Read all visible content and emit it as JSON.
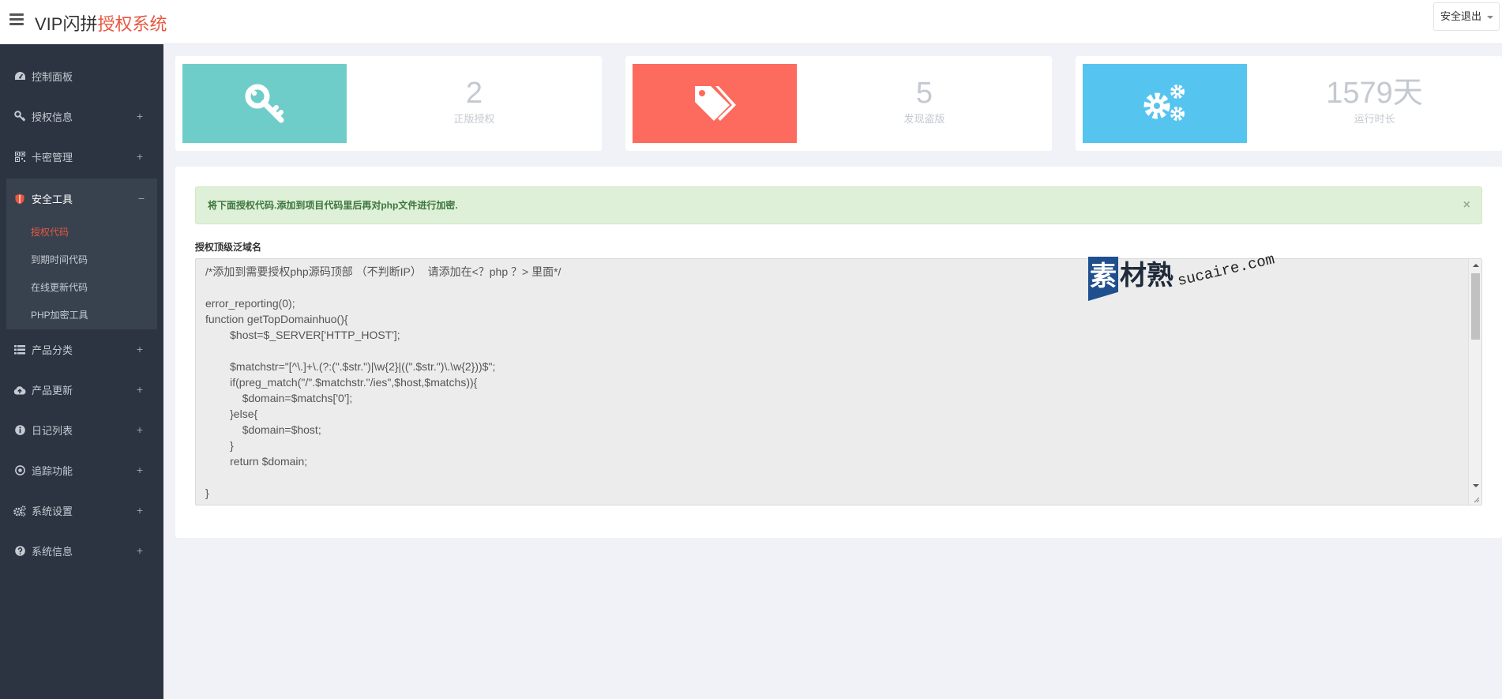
{
  "header": {
    "brand_main": "VIP闪拼",
    "brand_accent": "授权系统",
    "logout_label": "安全退出"
  },
  "sidebar": {
    "items": [
      {
        "label": "控制面板",
        "icon": "dashboard-icon"
      },
      {
        "label": "授权信息",
        "icon": "key-icon",
        "toggle": "+"
      },
      {
        "label": "卡密管理",
        "icon": "qrcode-icon",
        "toggle": "+"
      },
      {
        "label": "安全工具",
        "icon": "shield-icon",
        "toggle": "−",
        "children": [
          {
            "label": "授权代码",
            "active": true
          },
          {
            "label": "到期时间代码"
          },
          {
            "label": "在线更新代码"
          },
          {
            "label": "PHP加密工具"
          }
        ]
      },
      {
        "label": "产品分类",
        "icon": "list-icon",
        "toggle": "+"
      },
      {
        "label": "产品更新",
        "icon": "cloud-upload-icon",
        "toggle": "+"
      },
      {
        "label": "日记列表",
        "icon": "info-icon",
        "toggle": "+"
      },
      {
        "label": "追踪功能",
        "icon": "target-icon",
        "toggle": "+"
      },
      {
        "label": "系统设置",
        "icon": "gears-icon",
        "toggle": "+"
      },
      {
        "label": "系统信息",
        "icon": "question-icon",
        "toggle": "+"
      }
    ]
  },
  "stats": [
    {
      "value": "2",
      "label": "正版授权",
      "color": "#6ecdc8",
      "icon": "key-icon"
    },
    {
      "value": "5",
      "label": "发现盗版",
      "color": "#fd6a5e",
      "icon": "tags-icon"
    },
    {
      "value": "1579天",
      "label": "运行时长",
      "color": "#55c5ef",
      "icon": "gears-icon"
    }
  ],
  "alert": {
    "text": "将下面授权代码.添加到项目代码里后再对php文件进行加密.",
    "close": "×"
  },
  "code_field": {
    "label": "授权顶级泛域名",
    "content": "/*添加到需要授权php源码顶部 （不判断IP）  请添加在<？php ？> 里面*/\n\nerror_reporting(0);\nfunction getTopDomainhuo(){\n\t\t$host=$_SERVER['HTTP_HOST'];\n\n\t\t$matchstr=\"[^\\.]+\\.(?:(\".$str.\")|\\w{2}|((\".$str.\")\\.\\w{2}))$\";\n\t\tif(preg_match(\"/\".$matchstr.\"/ies\",$host,$matchs)){\n\t\t\t$domain=$matchs['0'];\n\t\t}else{\n\t\t\t$domain=$host;\n\t\t}\n\t\treturn $domain;\n\n}\n$domain=getTopDomainhuo();"
  },
  "watermark": {
    "char1": "素",
    "chars": "材熟",
    "domain": "sucaire.com"
  }
}
